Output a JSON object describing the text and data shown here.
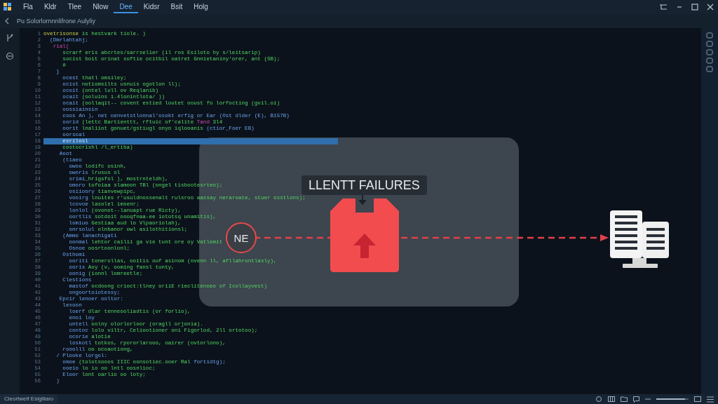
{
  "menu": [
    {
      "label": "Fla",
      "selected": false
    },
    {
      "label": "Kldr",
      "selected": false
    },
    {
      "label": "Tlee",
      "selected": false
    },
    {
      "label": "Nlow",
      "selected": false
    },
    {
      "label": "Dee",
      "selected": true
    },
    {
      "label": "Kidsr",
      "selected": false
    },
    {
      "label": "Bsit",
      "selected": false
    },
    {
      "label": "Holg",
      "selected": false
    }
  ],
  "breadcrumb": "Pu Solorlornnnlifrone Aulyliy",
  "lines": [
    {
      "num": "1",
      "selected": false,
      "parts": [
        {
          "kind": "name",
          "text": "ovetrisonse"
        },
        {
          "kind": "code",
          "text": " is hestvark tiole. )"
        }
      ]
    },
    {
      "num": "2",
      "selected": false,
      "parts": [
        {
          "kind": "keyword",
          "text": "  (Dmrlahtahj;"
        }
      ]
    },
    {
      "num": "3",
      "selected": false,
      "parts": [
        {
          "kind": "accent",
          "text": "   rial("
        }
      ]
    },
    {
      "num": "4",
      "selected": false,
      "parts": [
        {
          "kind": "code",
          "text": "      scrarf eris abcrtes/sarrselier (il ros Esiloto hy s/leitsarip)"
        }
      ]
    },
    {
      "num": "5",
      "selected": false,
      "parts": [
        {
          "kind": "code",
          "text": "      socist boit orinat softie ocitbil oatret Gnnietaniny'orer, ant (SB);"
        }
      ]
    },
    {
      "num": "6",
      "selected": false,
      "parts": [
        {
          "kind": "code",
          "text": "      #"
        }
      ]
    },
    {
      "num": "7",
      "selected": false,
      "parts": [
        {
          "kind": "keyword",
          "text": "    }"
        }
      ]
    },
    {
      "num": "8",
      "selected": false,
      "parts": [
        {
          "kind": "keyword",
          "text": "      ocest"
        },
        {
          "kind": "code",
          "text": " thatl omsiley;"
        }
      ]
    },
    {
      "num": "9",
      "selected": false,
      "parts": [
        {
          "kind": "keyword",
          "text": "      ocist"
        },
        {
          "kind": "code",
          "text": " notiomsilts usnuis ogotlon ll);"
        }
      ]
    },
    {
      "num": "10",
      "selected": false,
      "parts": [
        {
          "kind": "keyword",
          "text": "      ocoit"
        },
        {
          "kind": "code",
          "text": " (ontel lull ov Reqlanib)"
        }
      ]
    },
    {
      "num": "11",
      "selected": false,
      "parts": [
        {
          "kind": "keyword",
          "text": "      ocait"
        },
        {
          "kind": "code",
          "text": " (ooluins i.4lonintlota/ ))"
        }
      ]
    },
    {
      "num": "12",
      "selected": false,
      "parts": [
        {
          "kind": "keyword",
          "text": "      ocait"
        },
        {
          "kind": "code",
          "text": " (oollaqit-- covent estied loutet ooust fo lorfocting (gvil.oi)"
        }
      ]
    },
    {
      "num": "13",
      "selected": false,
      "parts": [
        {
          "kind": "keyword",
          "text": "      oossiainsin"
        }
      ]
    },
    {
      "num": "14",
      "selected": false,
      "parts": [
        {
          "kind": "keyword",
          "text": "      coos An ), net oenvetstlonnal'osokt erfig or Ear (Ost dlder (E), B157B)"
        }
      ]
    },
    {
      "num": "15",
      "selected": false,
      "parts": [
        {
          "kind": "keyword",
          "text": "      oorid"
        },
        {
          "kind": "code",
          "text": " (lettc Bartienttt, rftuic of'calite "
        },
        {
          "kind": "accent",
          "text": "Tand"
        },
        {
          "kind": "code",
          "text": " 3l4"
        }
      ]
    },
    {
      "num": "16",
      "selected": false,
      "parts": [
        {
          "kind": "keyword",
          "text": "      oorit"
        },
        {
          "kind": "code",
          "text": " lnaliiot gonuet/gstiugl onyo iqlooanis "
        },
        {
          "kind": "keyword",
          "text": "(ctior_Foer EB)"
        }
      ]
    },
    {
      "num": "17",
      "selected": false,
      "parts": [
        {
          "kind": "keyword",
          "text": "      oorsoal"
        }
      ]
    },
    {
      "num": "18",
      "selected": true,
      "parts": [
        {
          "kind": "keyword",
          "text": "      esrilosl"
        }
      ]
    },
    {
      "num": "19",
      "selected": false,
      "parts": [
        {
          "kind": "code",
          "text": "      costocrishl /l_ertiba)"
        }
      ]
    },
    {
      "num": "20",
      "selected": false,
      "parts": [
        {
          "kind": "keyword",
          "text": "     Aoot"
        }
      ]
    },
    {
      "num": "21",
      "selected": false,
      "parts": [
        {
          "kind": "keyword",
          "text": "      (tiaeo"
        }
      ]
    },
    {
      "num": "22",
      "selected": false,
      "parts": [
        {
          "kind": "keyword",
          "text": "        owoo"
        },
        {
          "kind": "code",
          "text": " lodifc osinh,"
        }
      ]
    },
    {
      "num": "23",
      "selected": false,
      "parts": [
        {
          "kind": "keyword",
          "text": "        oworis"
        },
        {
          "kind": "code",
          "text": " lrusus ol"
        }
      ]
    },
    {
      "num": "24",
      "selected": false,
      "parts": [
        {
          "kind": "keyword",
          "text": "        srimi"
        },
        {
          "kind": "code",
          "text": "_hrigsfol ), mostrnteldh),"
        }
      ]
    },
    {
      "num": "25",
      "selected": false,
      "parts": [
        {
          "kind": "keyword",
          "text": "        omoro"
        },
        {
          "kind": "code",
          "text": " tofoiaa slamoon TBl (ongel tisbootesrteo);"
        }
      ]
    },
    {
      "num": "26",
      "selected": false,
      "parts": [
        {
          "kind": "keyword",
          "text": "        osiioory"
        },
        {
          "kind": "code",
          "text": " tianvewpipc,"
        }
      ]
    },
    {
      "num": "27",
      "selected": false,
      "parts": [
        {
          "kind": "keyword",
          "text": "        vooirg"
        },
        {
          "kind": "code",
          "text": " lnuites r'usuldnossenalt rulsroo aassay neraroate, stuer osstlons);"
        }
      ]
    },
    {
      "num": "28",
      "selected": false,
      "parts": [
        {
          "kind": "keyword",
          "text": "        lcovoe"
        },
        {
          "kind": "code",
          "text": " lasolel imsenr;"
        }
      ]
    },
    {
      "num": "29",
      "selected": false,
      "parts": [
        {
          "kind": "keyword",
          "text": "        lonlol"
        },
        {
          "kind": "code",
          "text": " (ovonot--lanuapt rue Ricty),"
        }
      ]
    },
    {
      "num": "30",
      "selected": false,
      "parts": [
        {
          "kind": "keyword",
          "text": "        oortlis"
        },
        {
          "kind": "code",
          "text": " sotdoit oooqfnaa-ee iototsq unamitis),"
        }
      ]
    },
    {
      "num": "31",
      "selected": false,
      "parts": [
        {
          "kind": "keyword",
          "text": "        lomiuo"
        },
        {
          "kind": "code",
          "text": " Gestiaa aud lo Vlpaoriolah),"
        }
      ]
    },
    {
      "num": "32",
      "selected": false,
      "parts": [
        {
          "kind": "keyword",
          "text": "        onrsolul"
        },
        {
          "kind": "code",
          "text": " olnbanor owl asilothitionsl;"
        }
      ]
    },
    {
      "num": "33",
      "selected": false,
      "parts": [
        {
          "kind": "keyword",
          "text": "      (Ammo lanachigati"
        }
      ]
    },
    {
      "num": "34",
      "selected": false,
      "parts": [
        {
          "kind": "keyword",
          "text": "        oonmal"
        },
        {
          "kind": "code",
          "text": " lehtor cailii ga vie tunt ore oy Vatlemit"
        }
      ]
    },
    {
      "num": "35",
      "selected": false,
      "parts": [
        {
          "kind": "keyword",
          "text": "        Osnoe"
        },
        {
          "kind": "code",
          "text": " oosrtoonlonl;"
        }
      ]
    },
    {
      "num": "36",
      "selected": false,
      "parts": [
        {
          "kind": "keyword",
          "text": "      Osthomi"
        }
      ]
    },
    {
      "num": "37",
      "selected": false,
      "parts": [
        {
          "kind": "keyword",
          "text": "        ooriti"
        },
        {
          "kind": "code",
          "text": " tonerollas, ooitis ouf asinom (ovenn ll, afllahrontlasly),"
        }
      ]
    },
    {
      "num": "38",
      "selected": false,
      "parts": [
        {
          "kind": "keyword",
          "text": "        ooris"
        },
        {
          "kind": "code",
          "text": " Aoy (v, ooming fansl tunty,"
        }
      ]
    },
    {
      "num": "39",
      "selected": false,
      "parts": [
        {
          "kind": "keyword",
          "text": "        oonig"
        },
        {
          "kind": "code",
          "text": " (ionnl lomreetle;"
        }
      ]
    },
    {
      "num": "40",
      "selected": false,
      "parts": [
        {
          "kind": "keyword",
          "text": "      Clestions"
        }
      ]
    },
    {
      "num": "41",
      "selected": false,
      "parts": [
        {
          "kind": "keyword",
          "text": "        mastof"
        },
        {
          "kind": "code",
          "text": " ocdoong crioct:tlney oriiE rieclitenoeo of Icollayvest)"
        }
      ]
    },
    {
      "num": "42",
      "selected": false,
      "parts": [
        {
          "kind": "keyword",
          "text": "        ongoortoiotessy;"
        }
      ]
    },
    {
      "num": "43",
      "selected": false,
      "parts": [
        {
          "kind": "keyword",
          "text": "     Epcir lenoer ooltor:"
        }
      ]
    },
    {
      "num": "44",
      "selected": false,
      "parts": [
        {
          "kind": "keyword",
          "text": "      lexoon"
        }
      ]
    },
    {
      "num": "45",
      "selected": false,
      "parts": [
        {
          "kind": "keyword",
          "text": "        loerf"
        },
        {
          "kind": "code",
          "text": " dlar tenneooliadtis (or forlio),"
        }
      ]
    },
    {
      "num": "46",
      "selected": false,
      "parts": [
        {
          "kind": "keyword",
          "text": "        enoi loy"
        }
      ]
    },
    {
      "num": "47",
      "selected": false,
      "parts": [
        {
          "kind": "keyword",
          "text": "        untell"
        },
        {
          "kind": "code",
          "text": " oolny olorlorloor (oragll orjonia)."
        }
      ]
    },
    {
      "num": "48",
      "selected": false,
      "parts": [
        {
          "kind": "keyword",
          "text": "        contoc"
        },
        {
          "kind": "code",
          "text": " lolo viltr, Celiootioner oni Figorlod, 2ll ortotoo);"
        }
      ]
    },
    {
      "num": "49",
      "selected": false,
      "parts": [
        {
          "kind": "keyword",
          "text": "        ocorie"
        },
        {
          "kind": "code",
          "text": " alotie"
        }
      ]
    },
    {
      "num": "50",
      "selected": false,
      "parts": [
        {
          "kind": "keyword",
          "text": "        loskotl"
        },
        {
          "kind": "code",
          "text": " totkos, rpororlarooo, oairer (ovtorlono),"
        }
      ]
    },
    {
      "num": "51",
      "selected": false,
      "parts": [
        {
          "kind": "keyword",
          "text": "      rooolll"
        },
        {
          "kind": "code",
          "text": " oo ocoaotiong,"
        }
      ]
    },
    {
      "num": "52",
      "selected": false,
      "parts": [
        {
          "kind": "keyword",
          "text": "    / Plooke lorgol:"
        }
      ]
    },
    {
      "num": "53",
      "selected": false,
      "parts": [
        {
          "kind": "keyword",
          "text": "      omoe"
        },
        {
          "kind": "code",
          "text": " (tolotsooos IIIC oonsotiec.ooer Ral "
        },
        {
          "kind": "keyword",
          "text": "fortidtg);"
        }
      ]
    },
    {
      "num": "54",
      "selected": false,
      "parts": [
        {
          "kind": "keyword",
          "text": "      ooeio"
        },
        {
          "kind": "code",
          "text": " lo io oo lntl oosnlioc;"
        }
      ]
    },
    {
      "num": "55",
      "selected": false,
      "parts": [
        {
          "kind": "keyword",
          "text": "      Eloor"
        },
        {
          "kind": "code",
          "text": " lont oarlio oo loty;"
        }
      ]
    },
    {
      "num": "56",
      "selected": false,
      "parts": [
        {
          "kind": "keyword",
          "text": "    )"
        }
      ]
    }
  ],
  "overlay": {
    "callout": "LLENTT FAILURES",
    "node": "NE"
  },
  "status_bar": {
    "text": "Cleortwelf Eslglliaro",
    "zoom": {
      "level": 0.9
    }
  }
}
